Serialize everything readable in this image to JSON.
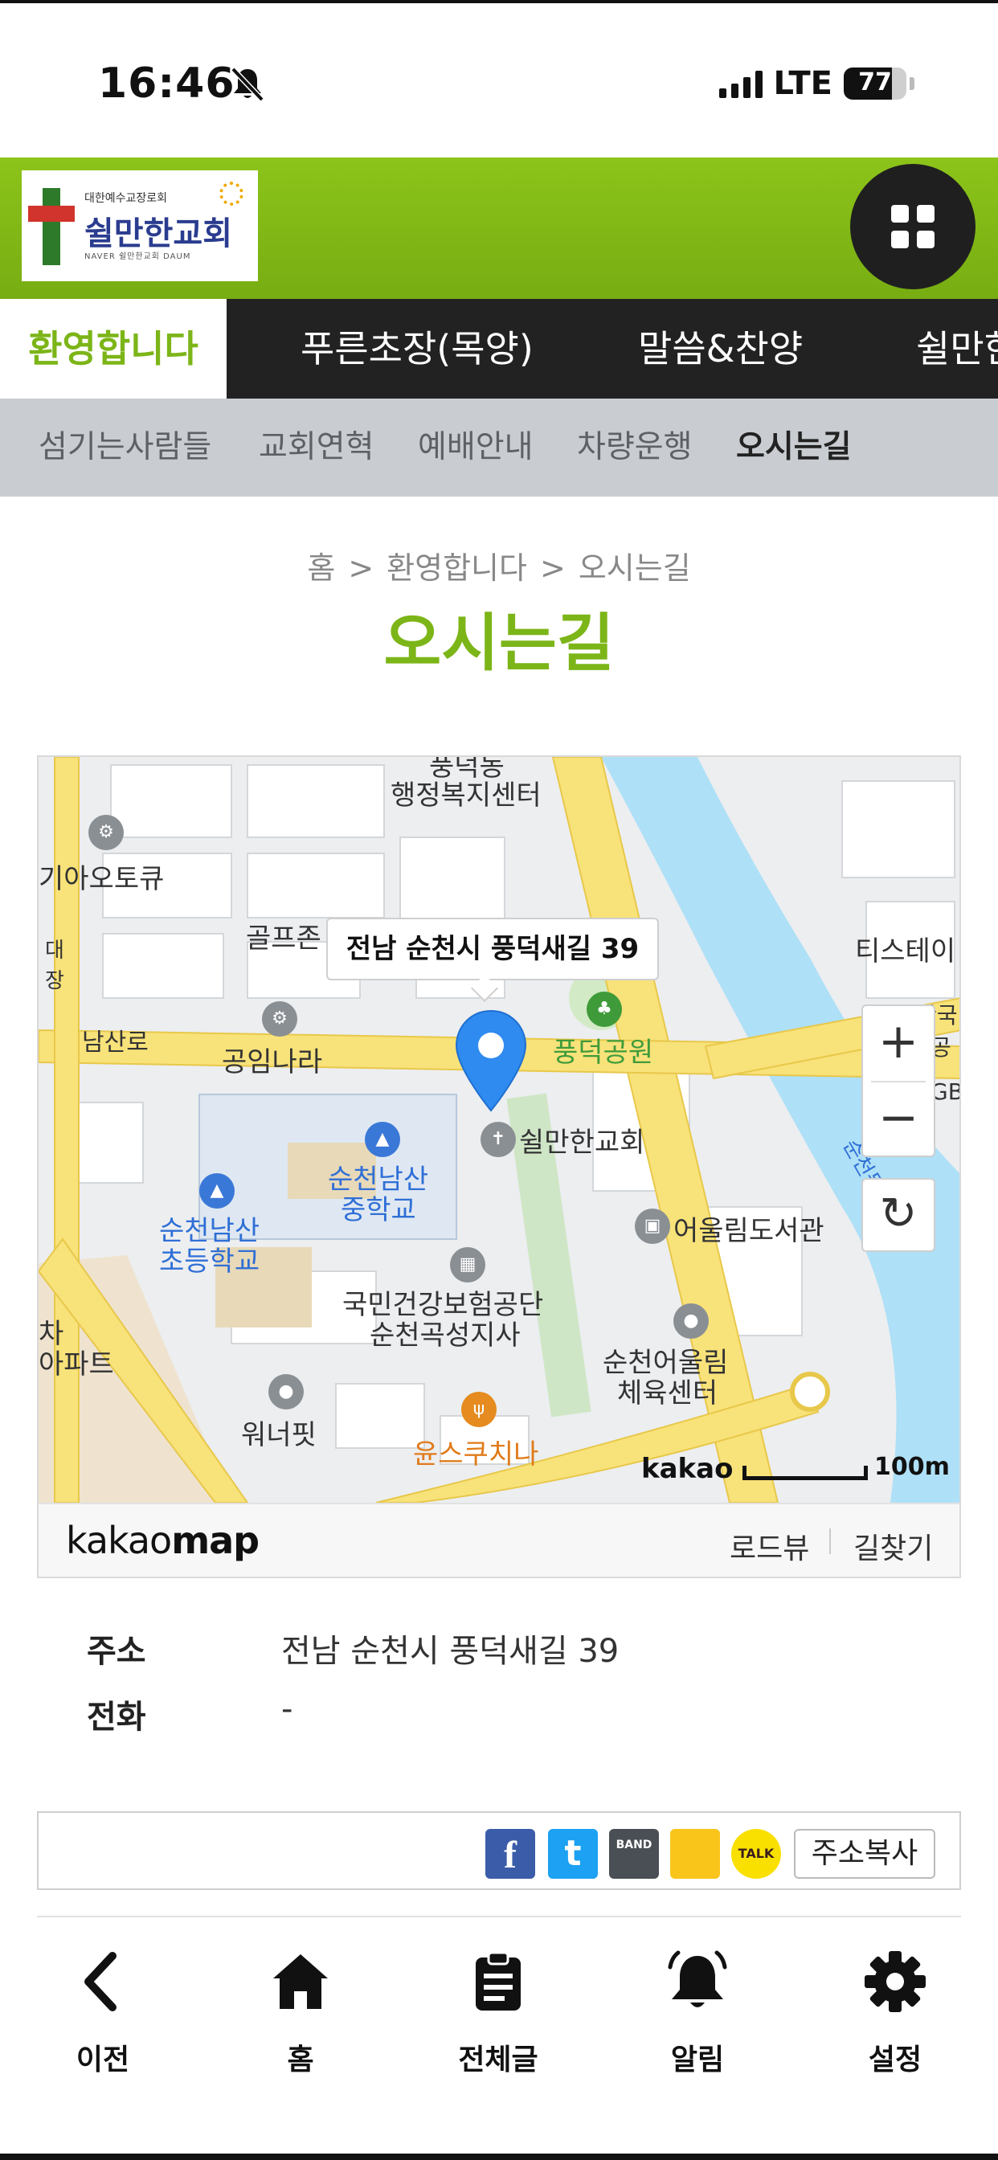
{
  "status_bar": {
    "time": "16:46",
    "network": "LTE",
    "battery": "77",
    "battery_level": 0.77
  },
  "header": {
    "logo": {
      "small_text": "대한예수교장로회",
      "name": "쉴만한교회",
      "sub_text": "NAVER 쉴만한교회 DAUM"
    },
    "menu_icon": "grid-icon"
  },
  "main_nav": {
    "items": [
      {
        "label": "환영합니다",
        "active": true
      },
      {
        "label": "푸른초장(목양)",
        "active": false
      },
      {
        "label": "말씀&찬양",
        "active": false
      },
      {
        "label": "쉴만한",
        "active": false
      }
    ]
  },
  "sub_nav": {
    "items": [
      {
        "label": "섬기는사람들",
        "active": false
      },
      {
        "label": "교회연혁",
        "active": false
      },
      {
        "label": "예배안내",
        "active": false
      },
      {
        "label": "차량운행",
        "active": false
      },
      {
        "label": "오시는길",
        "active": true
      }
    ]
  },
  "breadcrumb": {
    "items": [
      "홈",
      "환영합니다",
      "오시는길"
    ]
  },
  "page_title": "오시는길",
  "map": {
    "tooltip": "전남 순천시 풍덕새길 39",
    "labels": {
      "admin_center_top": "풍덕동",
      "admin_center": "행정복지센터",
      "kia_autoq": "기아오토큐",
      "golf_zone": "골프존",
      "tistation": "티스테이",
      "namsan_ro": "남산로",
      "gongim_nara": "공임나라",
      "pungdeok_park": "풍덕공원",
      "church": "쉴만한교회",
      "middle_school_1": "순천남산",
      "middle_school_2": "중학교",
      "elementary_1": "순천남산",
      "elementary_2": "초등학교",
      "library": "어울림도서관",
      "nhis_1": "국민건강보험공단",
      "nhis_2": "순천곡성지사",
      "apartment_1": "차",
      "apartment_2": "아파트",
      "sports_1": "순천어울림",
      "sports_2": "체육센터",
      "wonderfit": "워너핏",
      "yoonsu": "윤스쿠치나",
      "river": "순천동천",
      "side_1": "장",
      "side_2": "대",
      "right_1": "한국",
      "right_2": "공",
      "right_3": "GB"
    },
    "zoom_in": "+",
    "zoom_out": "−",
    "refresh": "↻",
    "attribution": "kakao",
    "scale": "100m",
    "footer": {
      "logo_light": "kakao",
      "logo_bold": "map",
      "roadview": "로드뷰",
      "directions": "길찾기"
    }
  },
  "info": {
    "address_label": "주소",
    "address_value": "전남 순천시 풍덕새길 39",
    "phone_label": "전화",
    "phone_value": "-"
  },
  "share": {
    "facebook": "f",
    "twitter": "t",
    "band": "BAND",
    "kakaostory": "",
    "kakaotalk": "TALK",
    "copy_address": "주소복사"
  },
  "tab_bar": {
    "items": [
      {
        "label": "이전",
        "icon": "back-icon"
      },
      {
        "label": "홈",
        "icon": "home-icon"
      },
      {
        "label": "전체글",
        "icon": "clipboard-icon"
      },
      {
        "label": "알림",
        "icon": "bell-icon"
      },
      {
        "label": "설정",
        "icon": "gear-icon"
      }
    ]
  },
  "colors": {
    "brand_green": "#7cb518",
    "nav_dark": "#222222",
    "subnav_gray": "#c9cdd1",
    "pin_blue": "#2f8bf0",
    "river_blue": "#aee0f7"
  }
}
